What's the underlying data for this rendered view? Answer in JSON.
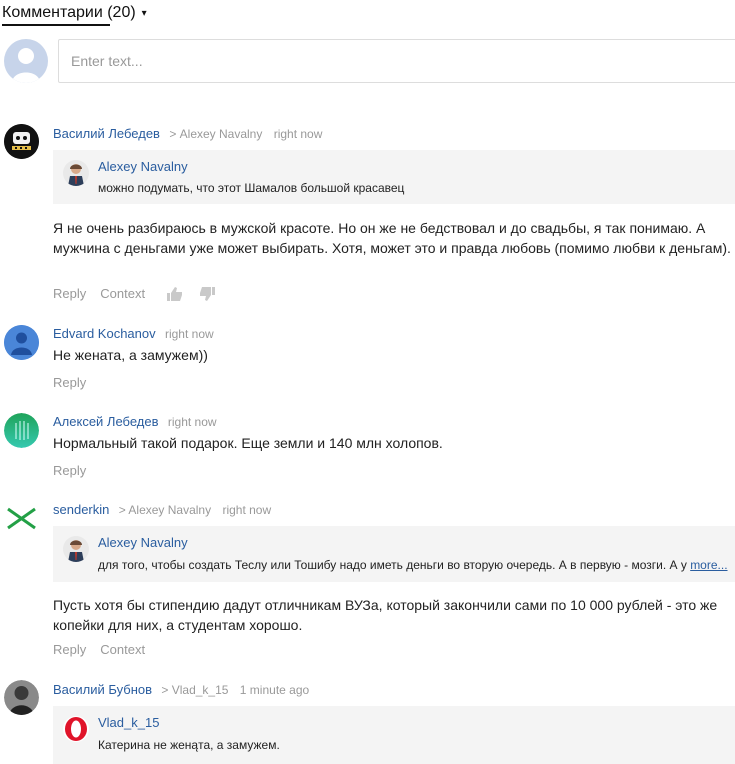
{
  "header": {
    "title": "Комментарии (20)",
    "caret": "▾"
  },
  "composer": {
    "placeholder": "Enter text..."
  },
  "comments": [
    {
      "author": "Василий Лебедев",
      "reply_to": "> Alexey Navalny",
      "time": "right now",
      "quote": {
        "author": "Alexey Navalny",
        "text": "можно подумать, что этот Шамалов большой красавец"
      },
      "text": "Я не очень разбираюсь в мужской красоте. Но он же не бедствовал и до свадьбы, я так понимаю. А мужчина с деньгами уже может выбирать. Хотя, может это и правда любовь (помимо любви к деньгам).",
      "actions": {
        "reply": "Reply",
        "context": "Context"
      }
    },
    {
      "author": "Edvard Kochanov",
      "time": "right now",
      "text": "Не жената, а замужем))",
      "actions": {
        "reply": "Reply"
      }
    },
    {
      "author": "Алексей Лебедев",
      "time": "right now",
      "text": "Нормальный такой подарок. Еще земли и 140 млн холопов.",
      "actions": {
        "reply": "Reply"
      }
    },
    {
      "author": "senderkin",
      "reply_to": "> Alexey Navalny",
      "time": "right now",
      "quote": {
        "author": "Alexey Navalny",
        "text": "для того, чтобы создать Теслу или Тошибу надо иметь деньги во вторую очередь. А в первую - мозги. А у",
        "more": "more..."
      },
      "text": "Пусть хотя бы стипендию дадут отличникам ВУЗа, который закончили сами по 10 000 рублей - это же копейки для них, а студентам хорошо.",
      "actions": {
        "reply": "Reply",
        "context": "Context"
      }
    },
    {
      "author": "Василий Бубнов",
      "reply_to": "> Vlad_k_15",
      "time": "1 minute ago",
      "quote": {
        "author": "Vlad_k_15",
        "text": "Катерина не женąта, а замужем."
      }
    }
  ],
  "colors": {
    "link": "#2a5d9f",
    "meta": "#999999",
    "quote_bg": "#f4f4f4"
  }
}
